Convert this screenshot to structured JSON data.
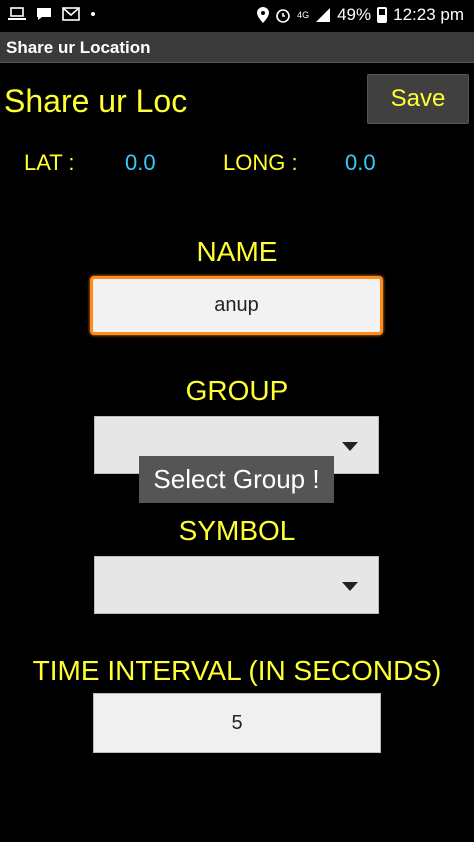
{
  "status_bar": {
    "left_icons": [
      "laptop-icon",
      "chat-icon",
      "mail-icon",
      "dot-icon"
    ],
    "network": "4G",
    "battery_percent": "49%",
    "time": "12:23 pm"
  },
  "app_title": "Share ur Location",
  "heading": "Share ur Loc",
  "save_label": "Save",
  "lat_label": "LAT :",
  "lat_value": "0.0",
  "long_label": "LONG :",
  "long_value": "0.0",
  "name_label": "NAME",
  "name_value": "anup",
  "group_label": "GROUP",
  "group_value": "",
  "symbol_label": "SYMBOL",
  "symbol_value": "",
  "toast_text": "Select Group !",
  "time_label": "TIME INTERVAL (IN SECONDS)",
  "time_value": "5",
  "colors": {
    "accent_yellow": "#ffff33",
    "value_blue": "#33ccff",
    "focus_orange": "#ff8c1a"
  }
}
